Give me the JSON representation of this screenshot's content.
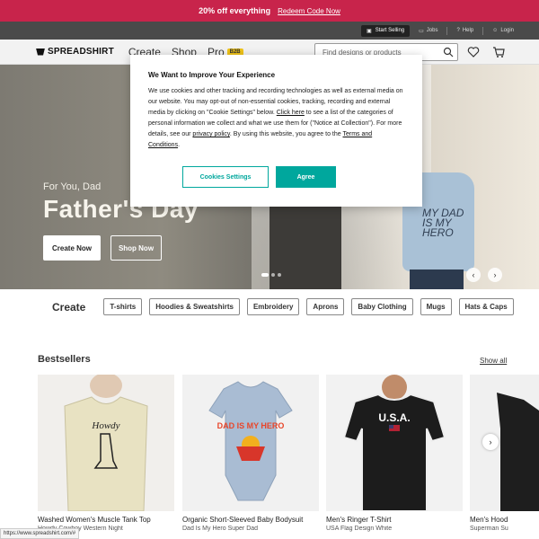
{
  "promo": {
    "text": "20% off everything",
    "link": "Redeem Code Now"
  },
  "utilbar": {
    "sell": "Start Selling",
    "jobs": "Jobs",
    "help": "Help",
    "login": "Login"
  },
  "header": {
    "logo": "SPREADSHIRT",
    "nav": [
      "Create",
      "Shop",
      "Pro"
    ],
    "b2b": "B2B",
    "search_placeholder": "Find designs or products"
  },
  "hero": {
    "subtitle": "For You, Dad",
    "title": "Father's Day",
    "create_label": "Create Now",
    "shop_label": "Shop Now",
    "kid_shirt_text": "MY DAD IS MY HERO"
  },
  "create": {
    "label": "Create",
    "chips": [
      "T-shirts",
      "Hoodies & Sweatshirts",
      "Embroidery",
      "Aprons",
      "Baby Clothing",
      "Mugs",
      "Hats & Caps"
    ]
  },
  "bestsellers": {
    "title": "Bestsellers",
    "show_all": "Show all",
    "products": [
      {
        "name": "Washed Women's Muscle Tank Top",
        "design": "Howdy Cowboy Western Night",
        "art": "Howdy"
      },
      {
        "name": "Organic Short-Sleeved Baby Bodysuit",
        "design": "Dad Is My Hero Super Dad",
        "art": "DAD IS MY HERO"
      },
      {
        "name": "Men's Ringer T-Shirt",
        "design": "USA Flag Design White",
        "art": "U.S.A."
      },
      {
        "name": "Men's Hood",
        "design": "Superman Su",
        "art": ""
      }
    ]
  },
  "modal": {
    "title": "We Want to Improve Your Experience",
    "body_1": "We use cookies and other tracking and recording technologies as well as external media on our website. You may opt-out of non-essential cookies, tracking, recording and external media by clicking on \"Cookie Settings\" below. ",
    "click_here": "Click here",
    "body_2": " to see a list of the categories of personal information we collect and what we use them for (\"Notice at Collection\"). For more details, see our ",
    "privacy": "privacy policy",
    "body_3": ". By using this website, you agree to the ",
    "terms": "Terms and Conditions",
    "body_4": ".",
    "settings_label": "Cookies Settings",
    "agree_label": "Agree"
  },
  "status_url": "https://www.spreadshirt.com/#",
  "colors": {
    "promo": "#c8244b",
    "accent": "#00a79d"
  }
}
